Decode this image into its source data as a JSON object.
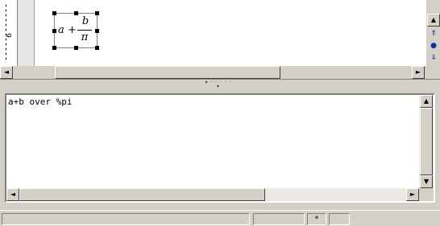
{
  "ruler": {
    "page_number": "6"
  },
  "formula": {
    "a": "a",
    "plus": "+",
    "numerator": "b",
    "denominator": "π"
  },
  "doc_scroll": {
    "up": "▲",
    "down": "▼",
    "left": "◄",
    "right": "►",
    "prev_page": "⇑",
    "navigate": "●",
    "next_page": "⇓"
  },
  "splitter": {
    "grip": "▾ · · · · · ▾"
  },
  "command": {
    "text": "a+b over %pi"
  },
  "cmd_scroll": {
    "up": "▲",
    "down": "▼",
    "left": "◄",
    "right": "►"
  },
  "status": {
    "modified": "*"
  },
  "colors": {
    "nav_blue": "#0a2ea8",
    "chrome": "#d4d0c8"
  }
}
